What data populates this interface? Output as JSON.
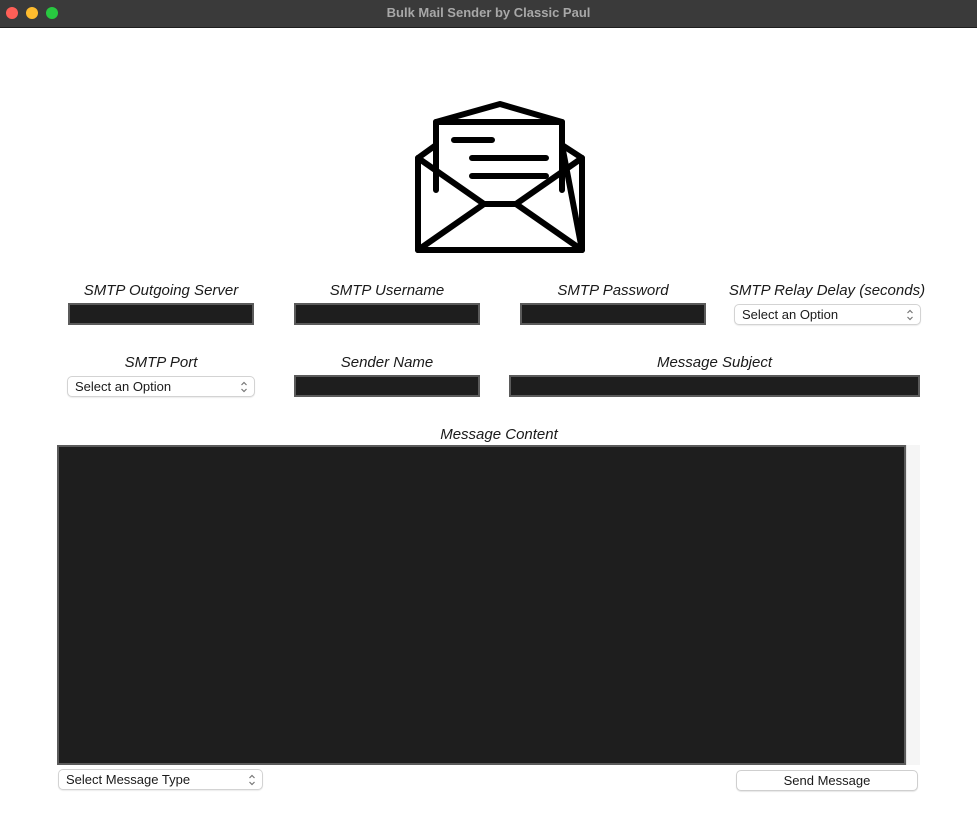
{
  "window": {
    "title": "Bulk Mail Sender by Classic Paul"
  },
  "form": {
    "smtp_server_label": "SMTP Outgoing Server",
    "smtp_username_label": "SMTP Username",
    "smtp_password_label": "SMTP Password",
    "smtp_delay_label": "SMTP Relay Delay (seconds)",
    "smtp_delay_select": "Select an Option",
    "smtp_port_label": "SMTP Port",
    "smtp_port_select": "Select an Option",
    "sender_name_label": "Sender Name",
    "message_subject_label": "Message Subject",
    "message_content_label": "Message Content",
    "message_type_select": "Select Message Type",
    "send_button": "Send Message"
  },
  "icons": {
    "logo": "envelope-open-icon",
    "chevron": "chevron-updown-icon"
  },
  "colors": {
    "field_bg": "#1e1e1e",
    "field_border": "#5b5b5b",
    "titlebar": "#3a3a3a"
  }
}
